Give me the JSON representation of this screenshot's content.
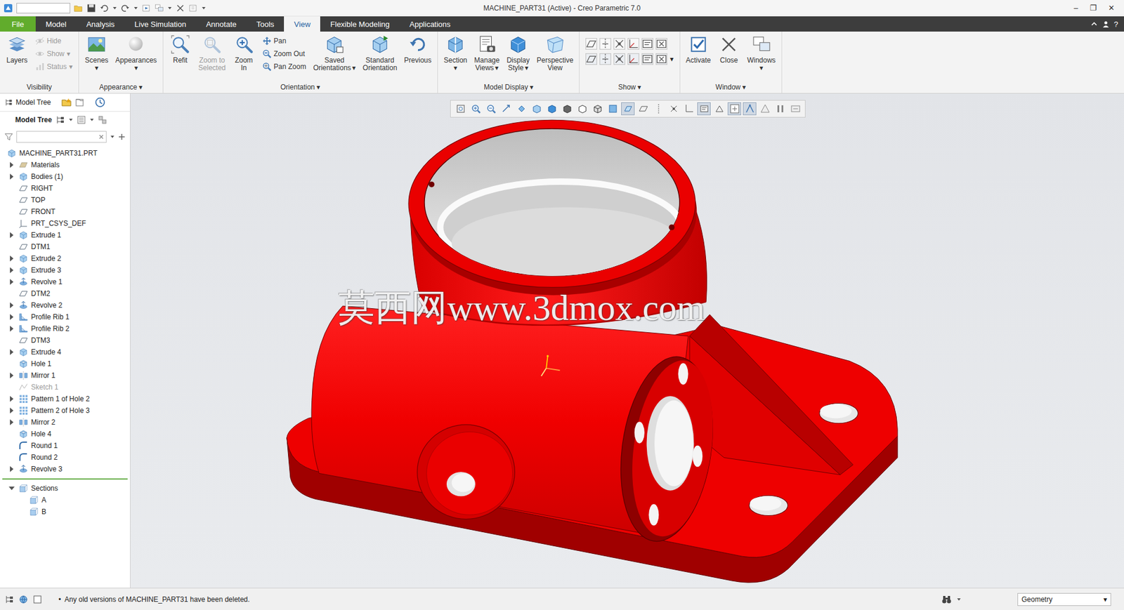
{
  "window": {
    "title": "MACHINE_PART31 (Active) - Creo Parametric 7.0",
    "controls": [
      "–",
      "❐",
      "✕"
    ]
  },
  "tabs": [
    {
      "label": "File",
      "kind": "file",
      "selected": false
    },
    {
      "label": "Model",
      "kind": "tab",
      "selected": false
    },
    {
      "label": "Analysis",
      "kind": "tab",
      "selected": false
    },
    {
      "label": "Live Simulation",
      "kind": "tab",
      "selected": false
    },
    {
      "label": "Annotate",
      "kind": "tab",
      "selected": false
    },
    {
      "label": "Tools",
      "kind": "tab",
      "selected": false
    },
    {
      "label": "View",
      "kind": "tab",
      "selected": true
    },
    {
      "label": "Flexible Modeling",
      "kind": "tab",
      "selected": false
    },
    {
      "label": "Applications",
      "kind": "tab",
      "selected": false
    }
  ],
  "help": "?",
  "ribbon": {
    "groups": [
      {
        "label": "Visibility",
        "items": [
          {
            "kind": "large",
            "lines": [
              "Layers"
            ],
            "disabled": false
          },
          {
            "kind": "stack",
            "entries": [
              {
                "label": "Hide",
                "disabled": true
              },
              {
                "label": "Show",
                "disabled": true,
                "arrow": "▾"
              },
              {
                "label": "Status",
                "disabled": true,
                "arrow": "▾"
              }
            ]
          }
        ]
      },
      {
        "label": "Appearance",
        "arrow": "▾",
        "items": [
          {
            "kind": "large",
            "lines": [
              "Scenes"
            ],
            "arrow": "▾",
            "disabled": false
          },
          {
            "kind": "large",
            "lines": [
              "Appearances"
            ],
            "arrow": "▾",
            "disabled": false
          }
        ]
      },
      {
        "label": "Orientation",
        "arrow": "▾",
        "items": [
          {
            "kind": "large",
            "lines": [
              "Refit"
            ],
            "disabled": false
          },
          {
            "kind": "large",
            "lines": [
              "Zoom to",
              "Selected"
            ],
            "disabled": true
          },
          {
            "kind": "large",
            "lines": [
              "Zoom",
              "In"
            ],
            "disabled": false
          },
          {
            "kind": "stack",
            "entries": [
              {
                "label": "Pan",
                "disabled": false
              },
              {
                "label": "Zoom Out",
                "disabled": false
              },
              {
                "label": "Pan Zoom",
                "disabled": false
              }
            ]
          },
          {
            "kind": "large",
            "lines": [
              "Saved",
              "Orientations"
            ],
            "arrow": "▾",
            "disabled": false
          },
          {
            "kind": "large",
            "lines": [
              "Standard",
              "Orientation"
            ],
            "disabled": false
          },
          {
            "kind": "large",
            "lines": [
              "Previous"
            ],
            "disabled": false
          }
        ]
      },
      {
        "label": "Model Display",
        "arrow": "▾",
        "items": [
          {
            "kind": "large",
            "lines": [
              "Section"
            ],
            "arrow": "▾",
            "disabled": false
          },
          {
            "kind": "large",
            "lines": [
              "Manage",
              "Views"
            ],
            "arrow": "▾",
            "disabled": false
          },
          {
            "kind": "large",
            "lines": [
              "Display",
              "Style"
            ],
            "arrow": "▾",
            "disabled": false
          },
          {
            "kind": "large",
            "lines": [
              "Perspective",
              "View"
            ],
            "disabled": false
          }
        ]
      },
      {
        "label": "Show",
        "arrow": "▾",
        "items": [
          {
            "kind": "grid",
            "arrow": "▾",
            "cells": [
              {
                "disabled": false
              },
              {
                "disabled": false
              },
              {
                "disabled": false
              },
              {
                "disabled": false
              },
              {
                "disabled": false
              },
              {
                "disabled": false
              },
              {
                "disabled": false
              },
              {
                "disabled": false
              },
              {
                "disabled": false
              },
              {
                "disabled": false
              },
              {
                "disabled": false
              },
              {
                "disabled": false
              }
            ]
          }
        ]
      },
      {
        "label": "Window",
        "arrow": "▾",
        "items": [
          {
            "kind": "large",
            "lines": [
              "Activate"
            ],
            "disabled": false
          },
          {
            "kind": "large",
            "lines": [
              "Close"
            ],
            "disabled": false
          },
          {
            "kind": "large",
            "lines": [
              "Windows"
            ],
            "arrow": "▾",
            "disabled": false
          }
        ]
      }
    ]
  },
  "model_tree": {
    "panel_tab": "Model Tree",
    "title": "Model Tree",
    "root": "MACHINE_PART31.PRT",
    "items": [
      {
        "label": "Materials",
        "kind": "materials",
        "expandable": true,
        "expanded": false,
        "disabled": false
      },
      {
        "label": "Bodies (1)",
        "kind": "bodies",
        "expandable": true,
        "expanded": false,
        "disabled": false
      },
      {
        "label": "RIGHT",
        "kind": "plane",
        "expandable": false,
        "disabled": false
      },
      {
        "label": "TOP",
        "kind": "plane",
        "expandable": false,
        "disabled": false
      },
      {
        "label": "FRONT",
        "kind": "plane",
        "expandable": false,
        "disabled": false
      },
      {
        "label": "PRT_CSYS_DEF",
        "kind": "csys",
        "expandable": false,
        "disabled": false
      },
      {
        "label": "Extrude 1",
        "kind": "extrude",
        "expandable": true,
        "expanded": false,
        "disabled": false
      },
      {
        "label": "DTM1",
        "kind": "plane",
        "expandable": false,
        "disabled": false
      },
      {
        "label": "Extrude 2",
        "kind": "extrude",
        "expandable": true,
        "expanded": false,
        "disabled": false
      },
      {
        "label": "Extrude 3",
        "kind": "extrude",
        "expandable": true,
        "expanded": false,
        "disabled": false
      },
      {
        "label": "Revolve 1",
        "kind": "revolve",
        "expandable": true,
        "expanded": false,
        "disabled": false
      },
      {
        "label": "DTM2",
        "kind": "plane",
        "expandable": false,
        "disabled": false
      },
      {
        "label": "Revolve 2",
        "kind": "revolve",
        "expandable": true,
        "expanded": false,
        "disabled": false
      },
      {
        "label": "Profile Rib 1",
        "kind": "rib",
        "expandable": true,
        "expanded": false,
        "disabled": false
      },
      {
        "label": "Profile Rib 2",
        "kind": "rib",
        "expandable": true,
        "expanded": false,
        "disabled": false
      },
      {
        "label": "DTM3",
        "kind": "plane",
        "expandable": false,
        "disabled": false
      },
      {
        "label": "Extrude 4",
        "kind": "extrude",
        "expandable": true,
        "expanded": false,
        "disabled": false
      },
      {
        "label": "Hole 1",
        "kind": "hole",
        "expandable": false,
        "disabled": false
      },
      {
        "label": "Mirror 1",
        "kind": "mirror",
        "expandable": true,
        "expanded": false,
        "disabled": false
      },
      {
        "label": "Sketch 1",
        "kind": "sketch",
        "expandable": false,
        "disabled": true
      },
      {
        "label": "Pattern 1 of Hole 2",
        "kind": "pattern",
        "expandable": true,
        "expanded": false,
        "disabled": false
      },
      {
        "label": "Pattern 2 of Hole 3",
        "kind": "pattern",
        "expandable": true,
        "expanded": false,
        "disabled": false
      },
      {
        "label": "Mirror 2",
        "kind": "mirror",
        "expandable": true,
        "expanded": false,
        "disabled": false
      },
      {
        "label": "Hole 4",
        "kind": "hole",
        "expandable": false,
        "disabled": false
      },
      {
        "label": "Round 1",
        "kind": "round",
        "expandable": false,
        "disabled": false
      },
      {
        "label": "Round 2",
        "kind": "round",
        "expandable": false,
        "disabled": false
      },
      {
        "label": "Revolve 3",
        "kind": "revolve",
        "expandable": true,
        "expanded": false,
        "disabled": false
      }
    ],
    "sections": {
      "label": "Sections",
      "expanded": true,
      "children": [
        "A",
        "B"
      ]
    }
  },
  "view_toolbar": [
    {
      "selected": false
    },
    {
      "selected": false
    },
    {
      "selected": false
    },
    {
      "selected": false
    },
    {
      "selected": false
    },
    {
      "selected": false
    },
    {
      "selected": false
    },
    {
      "selected": false
    },
    {
      "selected": false
    },
    {
      "selected": false
    },
    {
      "selected": false
    },
    {
      "selected": true
    },
    {
      "selected": false
    },
    {
      "selected": false
    },
    {
      "selected": false
    },
    {
      "selected": false
    },
    {
      "selected": true
    },
    {
      "selected": false
    },
    {
      "selected": true
    },
    {
      "selected": true
    },
    {
      "selected": false
    },
    {
      "selected": false
    },
    {
      "selected": false
    }
  ],
  "watermark": "莫西网www.3dmox.com",
  "status_bar": {
    "bullet": "•",
    "message": "Any old versions of MACHINE_PART31 have been deleted.",
    "filter": {
      "value": "Geometry",
      "arrow": "▾"
    }
  }
}
